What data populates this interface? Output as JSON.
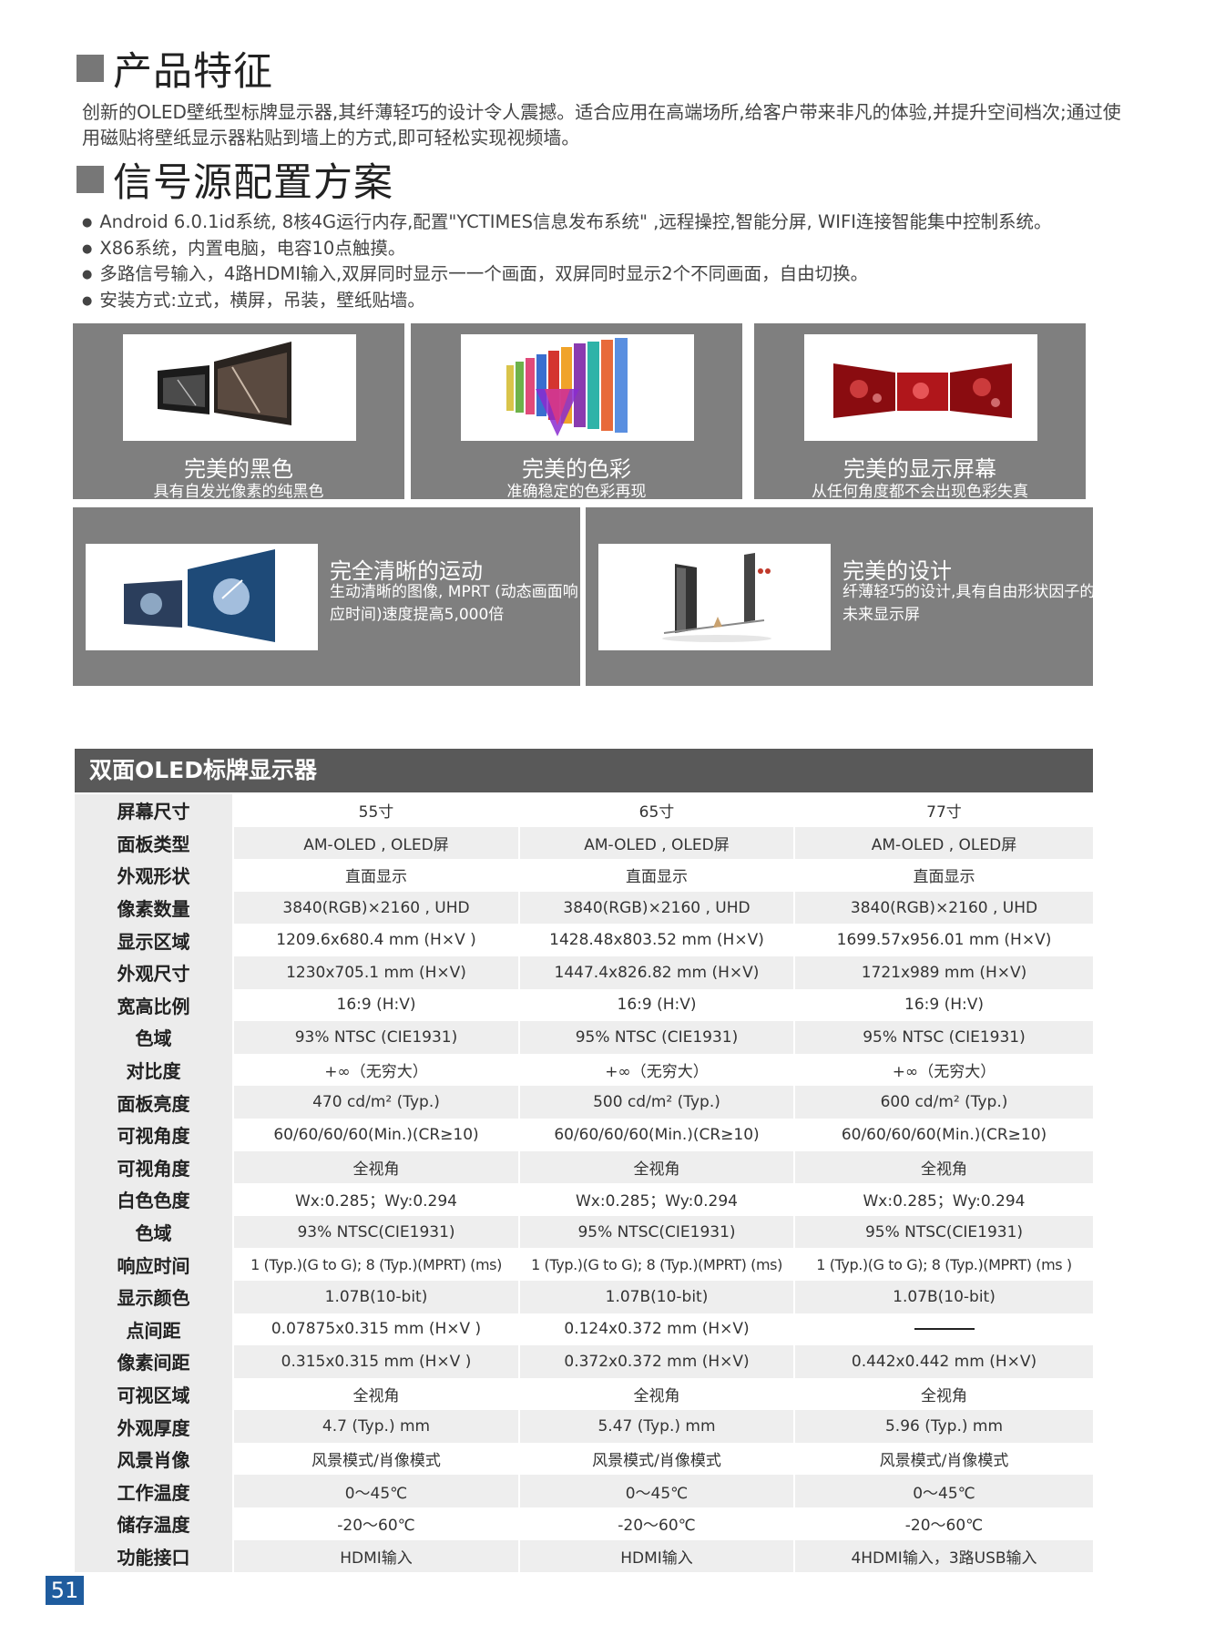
{
  "section1": {
    "title": "产品特征",
    "text": "创新的OLED壁纸型标牌显示器,其纤薄轻巧的设计令人震撼。适合应用在高端场所,给客户带来非凡的体验,并提升空间档次;通过使用磁贴将壁纸显示器粘贴到墙上的方式,即可轻松实现视频墙。"
  },
  "section2": {
    "title": "信号源配置方案",
    "bullets": [
      "Android 6.0.1id系统, 8核4G运行内存,配置\"YCTIMES信息发布系统\" ,远程操控,智能分屏, WIFI连接智能集中控制系统。",
      "X86系统，内置电脑，电容10点触摸。",
      "多路信号输入，4路HDMI输入,双屏同时显示一一个画面，双屏同时显示2个不同画面，自由切换。",
      "安装方式:立式，横屏，吊装，壁纸贴墙。"
    ]
  },
  "features": [
    {
      "title": "完美的黑色",
      "desc": "具有自发光像素的纯黑色"
    },
    {
      "title": "完美的色彩",
      "desc": "准确稳定的色彩再现"
    },
    {
      "title": "完美的显示屏幕",
      "desc": "从任何角度都不会出现色彩失真"
    },
    {
      "title": "完全清晰的运动",
      "desc": "生动清晰的图像, MPRT (动态画面响应时间)速度提高5,000倍"
    },
    {
      "title": "完美的设计",
      "desc": "纤薄轻巧的设计,具有自由形状因子的未来显示屏"
    }
  ],
  "table": {
    "title": "双面OLED标牌显示器",
    "rows": [
      {
        "label": "屏幕尺寸",
        "v": [
          "55寸",
          "65寸",
          "77寸"
        ]
      },
      {
        "label": "面板类型",
        "v": [
          "AM-OLED , OLED屏",
          "AM-OLED , OLED屏",
          "AM-OLED , OLED屏"
        ]
      },
      {
        "label": "外观形状",
        "v": [
          "直面显示",
          "直面显示",
          "直面显示"
        ]
      },
      {
        "label": "像素数量",
        "v": [
          "3840(RGB)×2160 , UHD",
          "3840(RGB)×2160 , UHD",
          "3840(RGB)×2160 , UHD"
        ]
      },
      {
        "label": "显示区域",
        "v": [
          "1209.6x680.4 mm (H×V )",
          "1428.48x803.52 mm (H×V)",
          "1699.57x956.01 mm (H×V)"
        ]
      },
      {
        "label": "外观尺寸",
        "v": [
          "1230x705.1 mm (H×V)",
          "1447.4x826.82 mm (H×V)",
          "1721x989 mm (H×V)"
        ]
      },
      {
        "label": "宽高比例",
        "v": [
          "16:9 (H:V)",
          "16:9 (H:V)",
          "16:9 (H:V)"
        ]
      },
      {
        "label": "色域",
        "v": [
          "93% NTSC (CIE1931)",
          "95% NTSC (CIE1931)",
          "95% NTSC (CIE1931)"
        ]
      },
      {
        "label": "对比度",
        "v": [
          "+∞（无穷大）",
          "+∞（无穷大）",
          "+∞（无穷大）"
        ]
      },
      {
        "label": "面板亮度",
        "v": [
          "470 cd/m² (Typ.)",
          "500 cd/m² (Typ.)",
          "600 cd/m² (Typ.)"
        ]
      },
      {
        "label": "可视角度",
        "v": [
          "60/60/60/60(Min.)(CR≥10)",
          "60/60/60/60(Min.)(CR≥10)",
          "60/60/60/60(Min.)(CR≥10)"
        ]
      },
      {
        "label": "可视角度",
        "v": [
          "全视角",
          "全视角",
          "全视角"
        ]
      },
      {
        "label": "白色色度",
        "v": [
          "Wx:0.285；Wy:0.294",
          "Wx:0.285；Wy:0.294",
          "Wx:0.285；Wy:0.294"
        ]
      },
      {
        "label": "色域",
        "v": [
          "93% NTSC(CIE1931)",
          "95% NTSC(CIE1931)",
          "95% NTSC(CIE1931)"
        ]
      },
      {
        "label": "响应时间",
        "v": [
          "1 (Typ.)(G to G); 8 (Typ.)(MPRT) (ms)",
          "1 (Typ.)(G to G); 8 (Typ.)(MPRT) (ms)",
          "1 (Typ.)(G to G); 8 (Typ.)(MPRT) (ms )"
        ]
      },
      {
        "label": "显示颜色",
        "v": [
          "1.07B(10-bit)",
          "1.07B(10-bit)",
          "1.07B(10-bit)"
        ]
      },
      {
        "label": "点间距",
        "v": [
          "0.07875x0.315 mm (H×V )",
          "0.124x0.372 mm (H×V)",
          ""
        ]
      },
      {
        "label": "像素间距",
        "v": [
          "0.315x0.315 mm (H×V )",
          "0.372x0.372 mm (H×V)",
          "0.442x0.442 mm (H×V)"
        ]
      },
      {
        "label": "可视区域",
        "v": [
          "全视角",
          "全视角",
          "全视角"
        ]
      },
      {
        "label": "外观厚度",
        "v": [
          "4.7 (Typ.) mm",
          "5.47 (Typ.) mm",
          "5.96 (Typ.) mm"
        ]
      },
      {
        "label": "风景肖像",
        "v": [
          "风景模式/肖像模式",
          "风景模式/肖像模式",
          "风景模式/肖像模式"
        ]
      },
      {
        "label": "工作温度",
        "v": [
          "0～45℃",
          "0～45℃",
          "0～45℃"
        ]
      },
      {
        "label": "储存温度",
        "v": [
          "-20～60℃",
          "-20～60℃",
          "-20～60℃"
        ]
      },
      {
        "label": "功能接口",
        "v": [
          "HDMI输入",
          "HDMI输入",
          "4HDMI输入，3路USB输入"
        ]
      }
    ]
  },
  "page_number": "51"
}
